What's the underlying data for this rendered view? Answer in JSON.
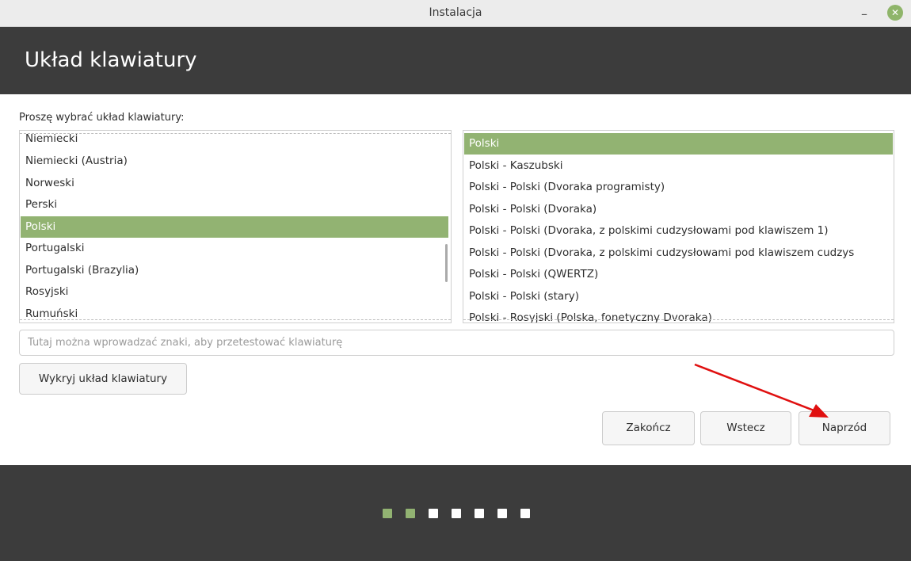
{
  "window": {
    "title": "Instalacja",
    "minimize_icon": "minimize-icon",
    "close_icon": "close-icon",
    "close_color": "#8fb56a"
  },
  "header": {
    "title": "Układ klawiatury"
  },
  "prompt": "Proszę wybrać układ klawiatury:",
  "layouts": {
    "items": [
      "Niemiecki",
      "Niemiecki (Austria)",
      "Norweski",
      "Perski",
      "Polski",
      "Portugalski",
      "Portugalski (Brazylia)",
      "Rosyjski",
      "Rumuński"
    ],
    "selected": "Polski"
  },
  "variants": {
    "items": [
      "Polski",
      "Polski - Kaszubski",
      "Polski - Polski (Dvoraka programisty)",
      "Polski - Polski (Dvoraka)",
      "Polski - Polski (Dvoraka, z polskimi cudzysłowami pod klawiszem 1)",
      "Polski - Polski (Dvoraka, z polskimi cudzysłowami pod klawiszem cudzys",
      "Polski - Polski (QWERTZ)",
      "Polski - Polski (stary)",
      "Polski - Rosyjski (Polska, fonetyczny Dvoraka)"
    ],
    "selected": "Polski"
  },
  "test_input": {
    "placeholder": "Tutaj można wprowadzać znaki, aby przetestować klawiaturę",
    "value": ""
  },
  "buttons": {
    "detect": "Wykryj układ klawiatury",
    "quit": "Zakończ",
    "back": "Wstecz",
    "next": "Naprzód"
  },
  "progress": {
    "total_steps": 7,
    "completed_steps": 2
  },
  "colors": {
    "accent": "#92b372",
    "header_bg": "#3c3c3c",
    "annotation_arrow": "#e01010"
  }
}
